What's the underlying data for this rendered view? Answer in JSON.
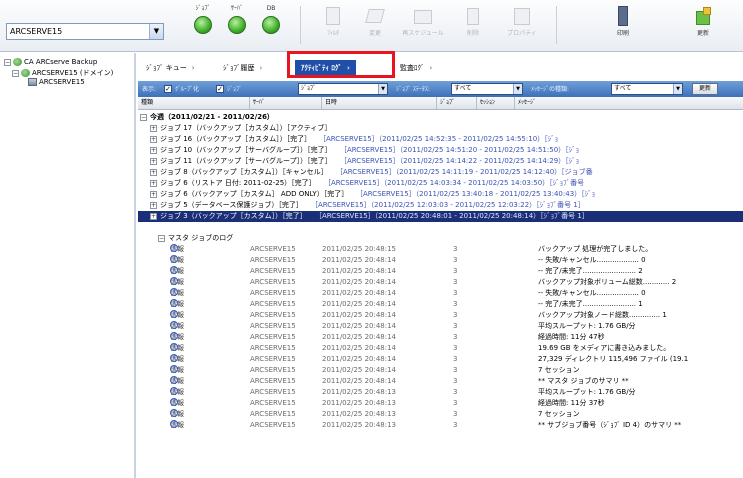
{
  "toolbar": {
    "server": "ARCSERVE15",
    "buttons": [
      {
        "label": "ｼﾞｮﾌﾞ",
        "icon": "status-green-icon",
        "enabled": true
      },
      {
        "label": "ｻｰﾊﾞ",
        "icon": "status-green-icon",
        "enabled": true
      },
      {
        "label": "DB",
        "icon": "status-green-icon",
        "enabled": true
      },
      {
        "label": "ﾌｨﾙﾀ",
        "icon": "filter-icon",
        "enabled": false
      },
      {
        "label": "変更",
        "icon": "edit-icon",
        "enabled": false
      },
      {
        "label": "再スケジュール",
        "icon": "reschedule-icon",
        "enabled": false
      },
      {
        "label": "削除",
        "icon": "delete-icon",
        "enabled": false
      },
      {
        "label": "プロパティ",
        "icon": "properties-icon",
        "enabled": false
      },
      {
        "label": "印刷",
        "icon": "print-icon",
        "enabled": true
      },
      {
        "label": "更新",
        "icon": "refresh-icon",
        "enabled": true
      }
    ]
  },
  "tree": {
    "root": "CA ARCserve Backup",
    "domain": "ARCSERVE15 (ドメイン)",
    "server": "ARCSERVE15"
  },
  "tabs": [
    {
      "label": "ｼﾞｮﾌﾞ キュー"
    },
    {
      "label": "ｼﾞｮﾌﾞ履歴"
    },
    {
      "label": "ｱｸﾃｨﾋﾞﾃｨ ﾛｸﾞ"
    },
    {
      "label": "監査ﾛｸﾞ"
    }
  ],
  "filters": {
    "show_label": "表示:",
    "group_label": "ｸﾞﾙｰﾌﾟ化",
    "job_label": "ｼﾞｮﾌﾞ",
    "group_value": "ｼﾞｮﾌﾞ",
    "status_label": "ｼﾞｮﾌﾞ ｽﾃｰﾀｽ:",
    "status_value": "すべて",
    "type_label": "ﾒｯｾｰｼﾞの種類:",
    "type_value": "すべて",
    "update_button": "更新"
  },
  "columns": [
    "種類",
    "ｻｰﾊﾞ",
    "日時",
    "ｼﾞｮﾌﾞ",
    "ｾｯｼｮﾝ",
    "ﾒｯｾｰｼﾞ"
  ],
  "group_header": "今週（2011/02/21 ‐ 2011/02/26）",
  "jobs": [
    {
      "text": "ジョブ 17（バックアップ［カスタム］）［アクティブ］",
      "trail": "",
      "selected": false
    },
    {
      "text": "ジョブ 16（バックアップ［カスタム］）［完了］",
      "trail": "［ARCSERVE15］（2011/02/25 14:52:35 ‐ 2011/02/25 14:55:10）［ｼﾞｮ",
      "selected": false
    },
    {
      "text": "ジョブ 10（バックアップ［サーバグループ］）［完了］",
      "trail": "［ARCSERVE15］（2011/02/25 14:51:20 ‐ 2011/02/25 14:51:50）［ｼﾞｮ",
      "selected": false
    },
    {
      "text": "ジョブ 11（バックアップ［サーバグループ］）［完了］",
      "trail": "［ARCSERVE15］（2011/02/25 14:14:22 ‐ 2011/02/25 14:14:29）［ｼﾞｮ",
      "selected": false
    },
    {
      "text": "ジョブ 8（バックアップ［カスタム］）［キャンセル］",
      "trail": "［ARCSERVE15］（2011/02/25 14:11:19 ‐ 2011/02/25 14:12:40）［ジョブ番",
      "selected": false
    },
    {
      "text": "ジョブ 6（リストア 日付: 2011-02-25）［完了］",
      "trail": "［ARCSERVE15］（2011/02/25 14:03:34 ‐ 2011/02/25 14:03:50）［ｼﾞｮﾌﾞ番号",
      "selected": false
    },
    {
      "text": "ジョブ 6（バックアップ［カスタム］ ADD ONLY）［完了］",
      "trail": "［ARCSERVE15］（2011/02/25 13:40:18 ‐ 2011/02/25 13:40:43）［ｼﾞｮ",
      "selected": false
    },
    {
      "text": "ジョブ 5（データベース保護ジョブ）［完了］",
      "trail": "［ARCSERVE15］（2011/02/25 12:03:03 ‐ 2011/02/25 12:03:22）［ｼﾞｮﾌﾞ番号 1］",
      "selected": false
    },
    {
      "text": "ジョブ 3（バックアップ［カスタム］）［完了］",
      "trail": "［ARCSERVE15］（2011/02/25 20:48:01 ‐ 2011/02/25 20:48:14）［ｼﾞｮﾌﾞ番号 1］",
      "selected": true
    }
  ],
  "master_log_label": "マスタ ジョブのログ",
  "messages": [
    {
      "sev": "情報",
      "server": "ARCSERVE15",
      "time": "2011/02/25 20:48:15",
      "job": "3",
      "msg": "バックアップ 処理が完了しました。"
    },
    {
      "sev": "情報",
      "server": "ARCSERVE15",
      "time": "2011/02/25 20:48:14",
      "job": "3",
      "msg": "‐‐ 失敗/キャンセル................... 0"
    },
    {
      "sev": "情報",
      "server": "ARCSERVE15",
      "time": "2011/02/25 20:48:14",
      "job": "3",
      "msg": "‐‐ 完了/未完了........................ 2"
    },
    {
      "sev": "情報",
      "server": "ARCSERVE15",
      "time": "2011/02/25 20:48:14",
      "job": "3",
      "msg": "バックアップ対象ボリューム総数............ 2"
    },
    {
      "sev": "情報",
      "server": "ARCSERVE15",
      "time": "2011/02/25 20:48:14",
      "job": "3",
      "msg": "‐‐ 失敗/キャンセル................... 0"
    },
    {
      "sev": "情報",
      "server": "ARCSERVE15",
      "time": "2011/02/25 20:48:14",
      "job": "3",
      "msg": "‐‐ 完了/未完了........................ 1"
    },
    {
      "sev": "情報",
      "server": "ARCSERVE15",
      "time": "2011/02/25 20:48:14",
      "job": "3",
      "msg": "バックアップ対象ノード総数.............. 1"
    },
    {
      "sev": "情報",
      "server": "ARCSERVE15",
      "time": "2011/02/25 20:48:14",
      "job": "3",
      "msg": "平均スループット: 1.76 GB/分"
    },
    {
      "sev": "情報",
      "server": "ARCSERVE15",
      "time": "2011/02/25 20:48:14",
      "job": "3",
      "msg": "経過時間: 11分 47秒"
    },
    {
      "sev": "情報",
      "server": "ARCSERVE15",
      "time": "2011/02/25 20:48:14",
      "job": "3",
      "msg": "19.69 GB をメディアに書き込みました。"
    },
    {
      "sev": "情報",
      "server": "ARCSERVE15",
      "time": "2011/02/25 20:48:14",
      "job": "3",
      "msg": "27,329 ディレクトリ 115,496 ファイル (19.1"
    },
    {
      "sev": "情報",
      "server": "ARCSERVE15",
      "time": "2011/02/25 20:48:14",
      "job": "3",
      "msg": "7 セッション"
    },
    {
      "sev": "情報",
      "server": "ARCSERVE15",
      "time": "2011/02/25 20:48:14",
      "job": "3",
      "msg": "** マスタ ジョブのサマリ **"
    },
    {
      "sev": "情報",
      "server": "ARCSERVE15",
      "time": "2011/02/25 20:48:13",
      "job": "3",
      "msg": "平均スループット: 1.76 GB/分"
    },
    {
      "sev": "情報",
      "server": "ARCSERVE15",
      "time": "2011/02/25 20:48:13",
      "job": "3",
      "msg": "経過時間: 11分 37秒"
    },
    {
      "sev": "情報",
      "server": "ARCSERVE15",
      "time": "2011/02/25 20:48:13",
      "job": "3",
      "msg": "7 セッション"
    },
    {
      "sev": "情報",
      "server": "ARCSERVE15",
      "time": "2011/02/25 20:48:13",
      "job": "3",
      "msg": "** サブジョブ番号（ｼﾞｮﾌﾞ ID 4）のサマリ **"
    }
  ]
}
